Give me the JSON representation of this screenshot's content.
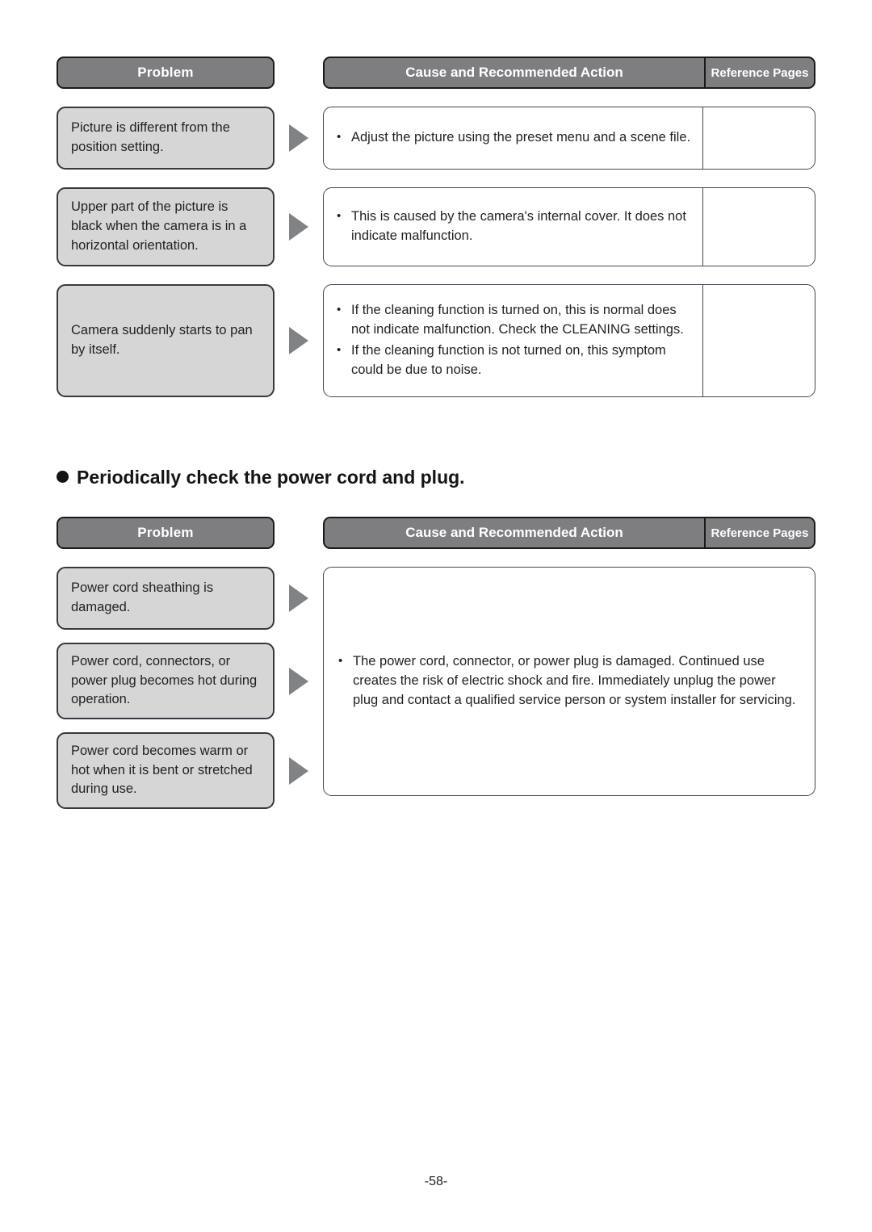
{
  "page": {
    "footer": "-58-"
  },
  "headers": {
    "problem": "Problem",
    "cause": "Cause and Recommended Action",
    "reference": "Reference Pages"
  },
  "bullet_char": "•",
  "section1": {
    "rows": [
      {
        "problem": "Picture is different from the position setting.",
        "causes": [
          "Adjust the picture using the preset menu and a scene file."
        ],
        "reference": ""
      },
      {
        "problem": "Upper part of the picture is black when the camera is in a horizontal orientation.",
        "causes": [
          "This is caused by the camera's internal cover. It does not indicate malfunction."
        ],
        "reference": ""
      },
      {
        "problem": "Camera suddenly starts to pan by itself.",
        "causes": [
          "If the cleaning function is turned on, this is normal does not indicate malfunction. Check the CLEANING settings.",
          "If the cleaning function is not turned on, this symptom could be due to noise."
        ],
        "reference": ""
      }
    ]
  },
  "section2": {
    "heading": "Periodically check the power cord and plug.",
    "problems": [
      "Power cord sheathing is damaged.",
      "Power cord, connectors, or power plug becomes hot during operation.",
      "Power cord becomes warm or hot when it is bent or stretched during use."
    ],
    "causes": [
      "The power cord, connector, or power plug is damaged. Continued use creates the risk of electric shock and fire. Immediately unplug the power plug and contact a qualified service person or system installer for servicing."
    ],
    "reference": ""
  }
}
